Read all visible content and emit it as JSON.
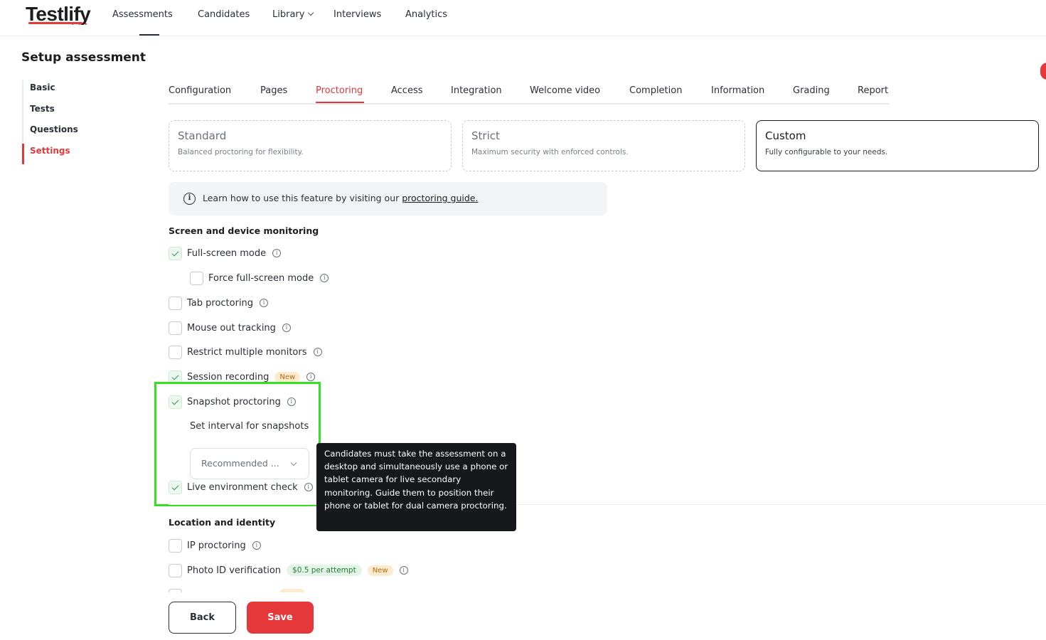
{
  "brand": {
    "name": "Testlify",
    "accent": "#e5383b",
    "dots": "• • •"
  },
  "nav": {
    "assessments": "Assessments",
    "candidates": "Candidates",
    "library": "Library",
    "interviews": "Interviews",
    "analytics": "Analytics"
  },
  "page_title": "Setup assessment",
  "sidebar": {
    "items": [
      {
        "label": "Basic"
      },
      {
        "label": "Tests"
      },
      {
        "label": "Questions"
      },
      {
        "label": "Settings",
        "active": true
      }
    ]
  },
  "tabs": [
    {
      "label": "Configuration"
    },
    {
      "label": "Pages"
    },
    {
      "label": "Proctoring",
      "active": true
    },
    {
      "label": "Access"
    },
    {
      "label": "Integration"
    },
    {
      "label": "Welcome video"
    },
    {
      "label": "Completion"
    },
    {
      "label": "Information"
    },
    {
      "label": "Grading"
    },
    {
      "label": "Report"
    }
  ],
  "modes": [
    {
      "title": "Standard",
      "desc": "Balanced proctoring for flexibility."
    },
    {
      "title": "Strict",
      "desc": "Maximum security with enforced controls."
    },
    {
      "title": "Custom",
      "desc": "Fully configurable to your needs.",
      "selected": true
    }
  ],
  "info_banner": {
    "text": "Learn how to use this feature by visiting our ",
    "link": "proctoring guide."
  },
  "screen_section": {
    "title": "Screen and device monitoring",
    "full_screen": {
      "label": "Full-screen mode",
      "checked": true
    },
    "force_full_screen": {
      "label": "Force full-screen mode",
      "checked": false
    },
    "tab_proctoring": {
      "label": "Tab proctoring",
      "checked": false
    },
    "mouse_out": {
      "label": "Mouse out tracking",
      "checked": false
    },
    "multiple_monitors": {
      "label": "Restrict multiple monitors",
      "checked": false
    },
    "session_recording": {
      "label": "Session recording",
      "badge": "New",
      "checked": true
    },
    "snapshot": {
      "label": "Snapshot proctoring",
      "checked": true
    },
    "interval_label": "Set interval for snapshots",
    "interval_value": "Recommended ...",
    "live_env": {
      "label": "Live environment check",
      "checked": true
    }
  },
  "tooltip": "Candidates must take the assessment on a desktop and simultaneously use a phone or tablet camera for live secondary monitoring. Guide them to position their phone or tablet for dual camera proctoring.",
  "location_section": {
    "title": "Location and identity",
    "ip": {
      "label": "IP proctoring",
      "checked": false
    },
    "photo_id": {
      "label": "Photo ID verification",
      "price": "$0.5 per attempt",
      "badge": "New",
      "checked": false
    }
  },
  "buttons": {
    "back": "Back",
    "save": "Save"
  },
  "icons": {
    "info": "info-icon",
    "chevron": "chevron-down-icon"
  }
}
